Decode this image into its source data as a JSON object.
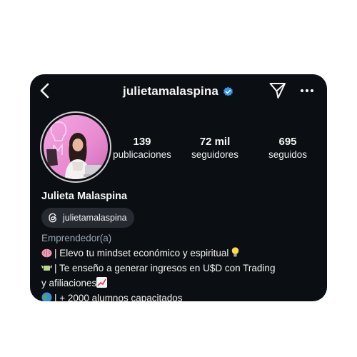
{
  "header": {
    "username": "julietamalaspina",
    "icons": {
      "back": "chevron-left-icon",
      "verified": "verified-badge-icon",
      "send": "paper-plane-icon",
      "more": "more-horizontal-icon"
    },
    "verified_color": "#3797f0"
  },
  "profile": {
    "display_name": "Julieta Malaspina",
    "threads_handle": "julietamalaspina",
    "category": "Emprendedor(a)"
  },
  "stats": [
    {
      "value": "139",
      "label": "publicaciones"
    },
    {
      "value": "72 mil",
      "label": "seguidores"
    },
    {
      "value": "695",
      "label": "seguidos"
    }
  ],
  "bio": {
    "line1": "| Elevo tu mindset económico y espiritual",
    "line2": "| Te enseño a generar ingresos en U$D con Trading",
    "line3": "y afiliaciones",
    "line4": "| + 2000 alumnos capacitados",
    "icons": [
      "brain-emoji",
      "bulb-emoji",
      "money-wings-emoji",
      "chart-up-emoji",
      "globe-emoji"
    ]
  },
  "colors": {
    "background": "#0b0e12",
    "text": "#f5f5f5",
    "category": "#9aa6b5",
    "pill": "#262a31"
  }
}
